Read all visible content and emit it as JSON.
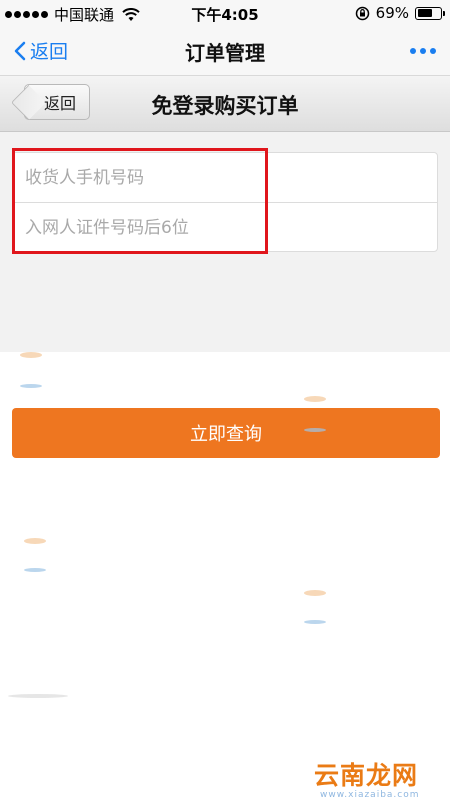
{
  "status_bar": {
    "carrier": "中国联通",
    "time": "下午4:05",
    "battery": "69%",
    "battery_level": 0.69
  },
  "nav": {
    "back_label": "返回",
    "title": "订单管理"
  },
  "page_header": {
    "back_label": "返回",
    "title": "免登录购买订单"
  },
  "form": {
    "phone_placeholder": "收货人手机号码",
    "id_placeholder": "入网人证件号码后6位",
    "submit_label": "立即查询"
  },
  "logo": {
    "text": "云南龙网",
    "url": "www.xiazaiba.com"
  },
  "colors": {
    "accent_blue": "#1a7ef0",
    "button_orange": "#ee7620",
    "highlight_red": "#e0161c"
  }
}
